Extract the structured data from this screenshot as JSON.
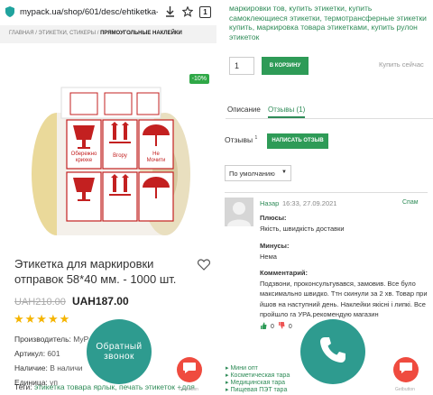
{
  "left": {
    "browser": {
      "url": "mypack.ua/shop/601/desc/ehtiketka-dlja-r",
      "tabs_count": "1"
    },
    "breadcrumb": {
      "home": "ГЛАВНАЯ",
      "sep1": " / ",
      "cat": "ЭТИКЕТКИ, СТИКЕРЫ",
      "sep2": " / ",
      "current": "ПРЯМОУГОЛЬНЫЕ НАКЛЕЙКИ"
    },
    "product": {
      "discount_badge": "-10%",
      "label_texts": [
        "Обережно крихке",
        "Вгору",
        "Не мочити"
      ],
      "title": "Этикетка для маркировки отправок 58*40 мм. - 1000 шт.",
      "old_price": "UAH210.00",
      "new_price": "UAH187.00",
      "rating": 5,
      "stars": "★★★★★",
      "attributes": [
        {
          "label": "Производитель:",
          "value": " MyP"
        },
        {
          "label": "Артикул:",
          "value": " 601"
        },
        {
          "label": "Наличие:",
          "value": " В наличи"
        },
        {
          "label": "Единица:",
          "value": " уп"
        }
      ],
      "tags_label": "Теги: ",
      "tags_value": "этикетка товара ярлык, печать этикеток +для"
    },
    "callback": {
      "line1": "Обратный",
      "line2": "звонок"
    },
    "getbutton": "Getbutton"
  },
  "right": {
    "tags_top": "маркировки тов, купить этикетки, купить самоклеющиеся этикетки, термотрансферные этикетки купить, маркировка товара этикетками, купить рулон этикеток",
    "quantity": "1",
    "add_to_cart": "В КОРЗИНУ",
    "buy_now": "Купить сейчас",
    "tabs": {
      "description": "Описание",
      "reviews": "Отзывы (1)"
    },
    "reviews_label": "Отзывы",
    "reviews_count": "1",
    "write_review": "НАПИСАТЬ ОТЗЫВ",
    "sort_select": "По умолчанию",
    "review": {
      "author": "Назар",
      "date": "16:33, 27.09.2021",
      "spam": "Спам",
      "pros_label": "Плюсы:",
      "pros": "Якість, швидкість доставки",
      "cons_label": "Минусы:",
      "cons": "Нема",
      "comment_label": "Комментарий:",
      "comment": "Подзвони, проконсультувався, замовив. Все було максимально швидко. Ттн скинули за 2 хв. Товар при йшов на наступний день. Наклейки якісні і липкі. Все пройшло гa УРА.рекомендую магазин",
      "likes": "0",
      "dislikes": "0"
    },
    "bottom_links": [
      "Мини опт",
      "Косметическая тара",
      "Медицинская тара",
      "Пищевая ПЭТ тара"
    ],
    "getbutton": "Getbutton"
  },
  "colors": {
    "accent_green": "#2e9b57",
    "teal": "#2e9b8f",
    "red_fab": "#ef4b3f",
    "star": "#f5b400"
  }
}
